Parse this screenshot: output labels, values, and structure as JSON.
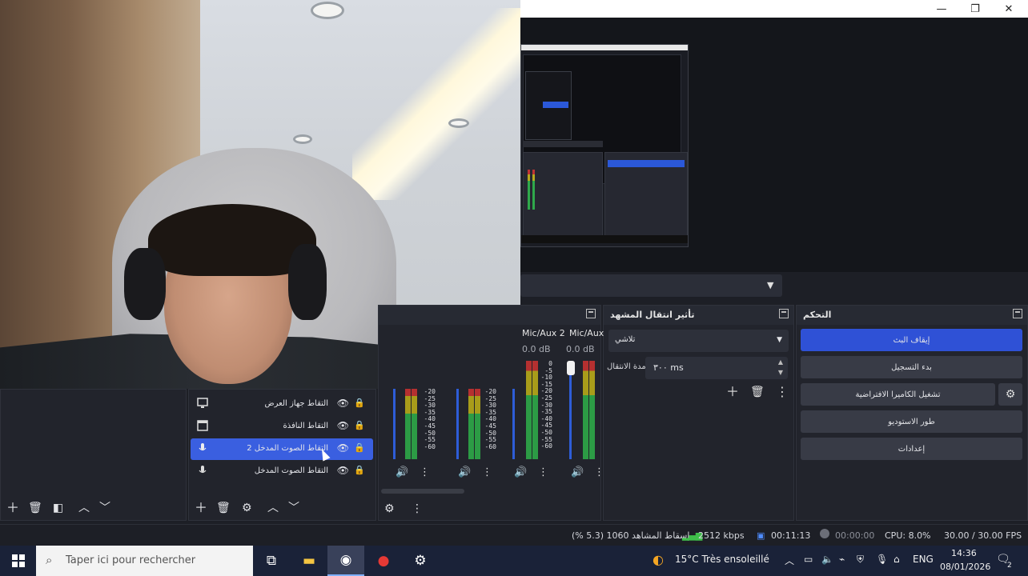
{
  "window": {
    "minimize": "—",
    "maximize": "❐",
    "close": "✕"
  },
  "controls": {
    "title": "التحكم",
    "stop_stream": "إيقاف البث",
    "start_recording": "بدء التسجيل",
    "virtual_camera": "تشغيل الكاميرا الافتراضية",
    "studio_mode": "طور الاستوديو",
    "settings": "إعدادات"
  },
  "transitions": {
    "title": "تأثير انتقال المشهد",
    "selected": "تلاشي",
    "duration_label": "مدة الانتقال",
    "duration_value": "٣٠٠ ms"
  },
  "mixer": {
    "channels": [
      {
        "name": "Mic/Aux 2",
        "db": "0.0 dB"
      },
      {
        "name": "Mic/Aux",
        "db": "0.0 dB"
      }
    ],
    "scale_left": "-20\n-25\n-30\n-35\n-40\n-45\n-50\n-55\n-60",
    "scale_mid": "-20\n-25\n-30\n-35\n-40\n-45\n-50\n-55\n-60",
    "scale_right": "0\n-5\n-10\n-15\n-20\n-25\n-30\n-35\n-40\n-45\n-50\n-55\n-60",
    "scale_partial": "-20\n-25\n-30\n-35\n-40\n-45\n-50\n-55\n-60"
  },
  "sources": [
    {
      "label": "التقاط جهاز العرض",
      "icon": "monitor-icon"
    },
    {
      "label": "التقاط النافذة",
      "icon": "window-icon"
    },
    {
      "label": "التقاط الصوت المدخل 2",
      "icon": "mic-icon",
      "selected": true
    },
    {
      "label": "التقاط الصوت المدخل",
      "icon": "mic-icon"
    }
  ],
  "status": {
    "dropped_frames": "إسقاط المشاهد 1060 (5.3 %)",
    "bitrate": "2512 kbps",
    "stream_time": "00:11:13",
    "record_time": "00:00:00",
    "cpu": "CPU: 8.0%",
    "fps": "30.00 / 30.00 FPS"
  },
  "taskbar": {
    "search_placeholder": "Taper ici pour rechercher",
    "weather": "15°C  Très ensoleillé",
    "lang": "ENG",
    "time": "14:36",
    "date": "08/01/2026",
    "notif_count": "2"
  }
}
